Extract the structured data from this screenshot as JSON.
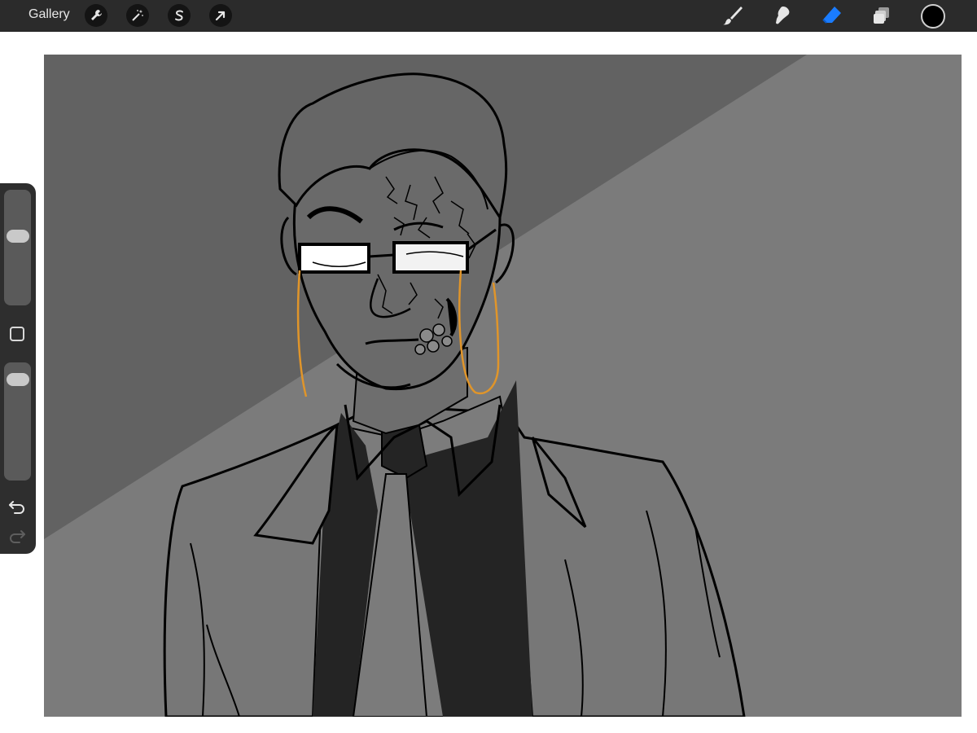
{
  "toolbar": {
    "gallery_label": "Gallery",
    "left_tools": [
      {
        "name": "actions",
        "icon": "wrench-icon"
      },
      {
        "name": "adjustments",
        "icon": "magic-wand-icon"
      },
      {
        "name": "selection",
        "icon": "selection-s-icon"
      },
      {
        "name": "transform",
        "icon": "arrow-cursor-icon"
      }
    ],
    "right_tools": [
      {
        "name": "brush",
        "icon": "brush-icon",
        "active": false
      },
      {
        "name": "smudge",
        "icon": "smudge-icon",
        "active": false
      },
      {
        "name": "eraser",
        "icon": "eraser-icon",
        "active": true
      },
      {
        "name": "layers",
        "icon": "layers-icon",
        "active": false
      }
    ],
    "current_color": "#000000",
    "active_tool_color": "#1a7cff"
  },
  "sidebar": {
    "brush_size_level": 0.62,
    "opacity_level": 0.08,
    "modify_button_icon": "square-icon",
    "undo_icon": "undo-icon",
    "redo_icon": "redo-icon"
  },
  "canvas": {
    "background_light": "#7b7b7b",
    "background_dark": "#626262",
    "line_color": "#000000",
    "accent_color": "#e0952a"
  }
}
